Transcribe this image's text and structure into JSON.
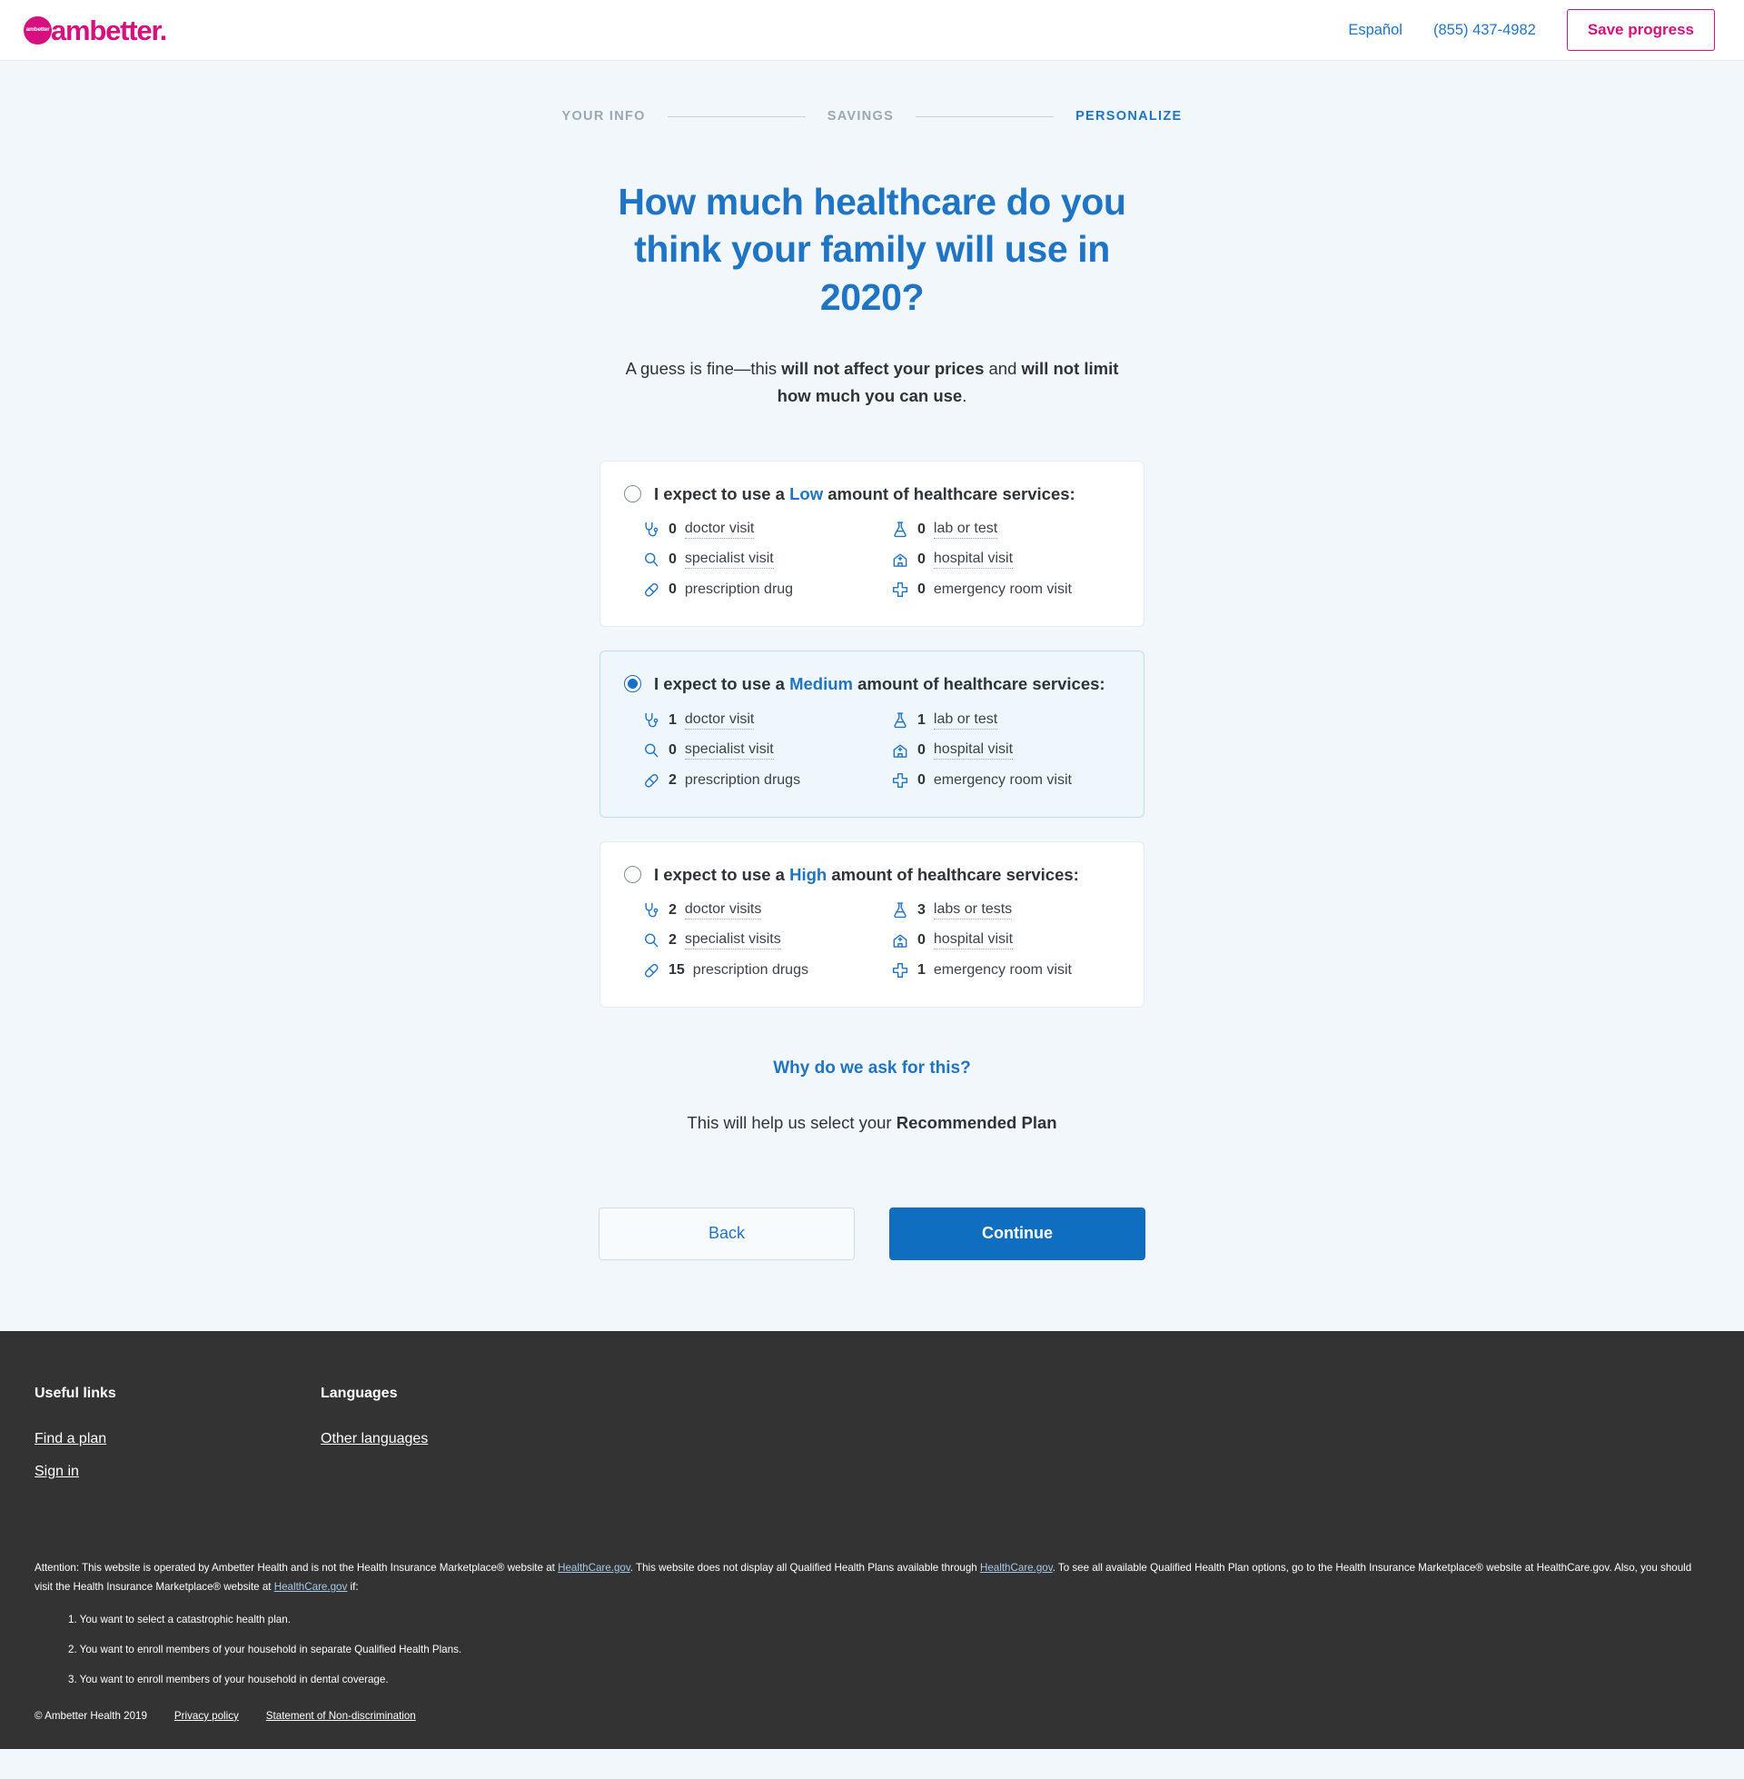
{
  "header": {
    "logo_badge_text": "ambetter",
    "logo_text": "ambetter.",
    "espanol_label": "Español",
    "phone": "(855) 437-4982",
    "save_progress_label": "Save progress"
  },
  "stepper": {
    "steps": [
      {
        "label": "YOUR INFO",
        "active": false
      },
      {
        "label": "SAVINGS",
        "active": false
      },
      {
        "label": "PERSONALIZE",
        "active": true
      }
    ]
  },
  "main": {
    "title": "How much healthcare do you think your family will use in 2020?",
    "subtitle_part1": "A guess is fine—this ",
    "subtitle_bold1": "will not affect your prices",
    "subtitle_part2": " and ",
    "subtitle_bold2": "will not limit how much you can use",
    "subtitle_part3": ".",
    "why_link": "Why do we ask for this?",
    "why_sub_prefix": "This will help us select your ",
    "why_sub_bold": "Recommended Plan",
    "back_label": "Back",
    "continue_label": "Continue"
  },
  "options": [
    {
      "level": "Low",
      "selected": false,
      "title_prefix": "I expect to use a ",
      "title_suffix": " amount of healthcare services:",
      "services": [
        {
          "icon": "stethoscope-icon",
          "count": "0",
          "label": "doctor visit",
          "hinted": true
        },
        {
          "icon": "flask-icon",
          "count": "0",
          "label": "lab or test",
          "hinted": true
        },
        {
          "icon": "magnifier-icon",
          "count": "0",
          "label": "specialist visit",
          "hinted": true
        },
        {
          "icon": "hospital-icon",
          "count": "0",
          "label": "hospital visit",
          "hinted": true
        },
        {
          "icon": "pill-icon",
          "count": "0",
          "label": "prescription drug",
          "hinted": false
        },
        {
          "icon": "medical-cross-icon",
          "count": "0",
          "label": "emergency room visit",
          "hinted": false
        }
      ]
    },
    {
      "level": "Medium",
      "selected": true,
      "title_prefix": "I expect to use a ",
      "title_suffix": " amount of healthcare services:",
      "services": [
        {
          "icon": "stethoscope-icon",
          "count": "1",
          "label": "doctor visit",
          "hinted": true
        },
        {
          "icon": "flask-icon",
          "count": "1",
          "label": "lab or test",
          "hinted": true
        },
        {
          "icon": "magnifier-icon",
          "count": "0",
          "label": "specialist visit",
          "hinted": true
        },
        {
          "icon": "hospital-icon",
          "count": "0",
          "label": "hospital visit",
          "hinted": true
        },
        {
          "icon": "pill-icon",
          "count": "2",
          "label": "prescription drugs",
          "hinted": false
        },
        {
          "icon": "medical-cross-icon",
          "count": "0",
          "label": "emergency room visit",
          "hinted": false
        }
      ]
    },
    {
      "level": "High",
      "selected": false,
      "title_prefix": "I expect to use a ",
      "title_suffix": " amount of healthcare services:",
      "services": [
        {
          "icon": "stethoscope-icon",
          "count": "2",
          "label": "doctor visits",
          "hinted": true
        },
        {
          "icon": "flask-icon",
          "count": "3",
          "label": "labs or tests",
          "hinted": true
        },
        {
          "icon": "magnifier-icon",
          "count": "2",
          "label": "specialist visits",
          "hinted": true
        },
        {
          "icon": "hospital-icon",
          "count": "0",
          "label": "hospital visit",
          "hinted": true
        },
        {
          "icon": "pill-icon",
          "count": "15",
          "label": "prescription drugs",
          "hinted": false
        },
        {
          "icon": "medical-cross-icon",
          "count": "1",
          "label": "emergency room visit",
          "hinted": false
        }
      ]
    }
  ],
  "footer": {
    "columns": [
      {
        "heading": "Useful links",
        "links": [
          "Find a plan",
          "Sign in"
        ]
      },
      {
        "heading": "Languages",
        "links": [
          "Other languages"
        ]
      }
    ],
    "legal_a": "Attention: This website is operated by Ambetter Health and is not the Health Insurance Marketplace® website at ",
    "legal_link1": "HealthCare.gov",
    "legal_b": ". This website does not display all Qualified Health Plans available through ",
    "legal_link2": "HealthCare.gov",
    "legal_c": ". To see all available Qualified Health Plan options, go to the Health Insurance Marketplace® website at HealthCare.gov. Also, you should visit the Health Insurance Marketplace® website at ",
    "legal_link3": "HealthCare.gov",
    "legal_d": " if:",
    "legal_items": [
      "1. You want to select a catastrophic health plan.",
      "2. You want to enroll members of your household in separate Qualified Health Plans.",
      "3. You want to enroll members of your household in dental coverage."
    ],
    "copyright": "© Ambetter Health 2019",
    "privacy_label": "Privacy policy",
    "nondiscrimination_label": "Statement of Non-discrimination"
  },
  "colors": {
    "brand_pink": "#d6117f",
    "accent_blue": "#1f74c4",
    "primary_button": "#0f6ec0",
    "page_background": "#f2f7fb",
    "footer_background": "#333333",
    "selected_card_background": "#eff7fd"
  }
}
